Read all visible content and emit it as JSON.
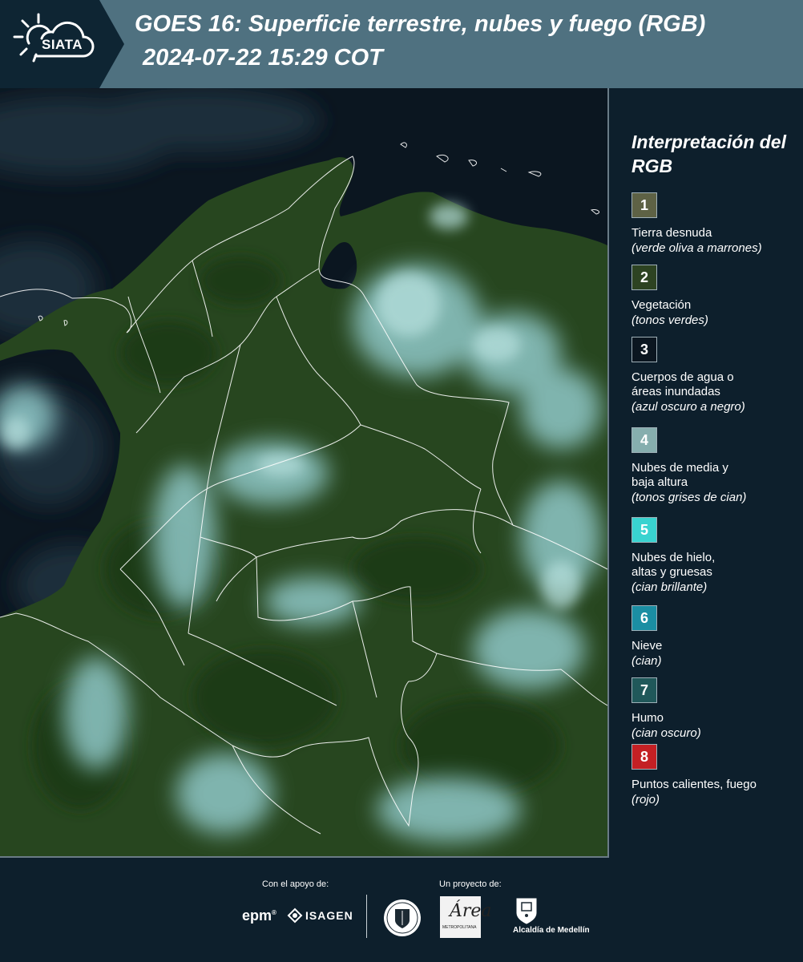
{
  "header": {
    "logo_text": "SIATA",
    "title_line1": "GOES 16: Superficie terrestre, nubes y fuego (RGB)",
    "title_line2": "2024-07-22 15:29 COT"
  },
  "map": {
    "icon": "satellite-image",
    "colors": {
      "ocean": "#0b1620",
      "vegetation": "#27461f",
      "cloud": "#8fc8c8",
      "boundary": "#ffffff"
    }
  },
  "legend": {
    "title": "Interpretación del RGB",
    "items": [
      {
        "number": "1",
        "label": "Tierra desnuda",
        "sub": "(verde oliva a marrones)",
        "color": "#5e6245"
      },
      {
        "number": "2",
        "label": "Vegetación",
        "sub": "(tonos verdes)",
        "color": "#2d4322"
      },
      {
        "number": "3",
        "label": "Cuerpos de agua o áreas inundadas",
        "sub": "(azul oscuro a negro)",
        "color": "#0b1620"
      },
      {
        "number": "4",
        "label": "Nubes de media y baja altura",
        "sub": "(tonos grises de cian)",
        "color": "#86aeae"
      },
      {
        "number": "5",
        "label": "Nubes de hielo, altas y gruesas",
        "sub": "(cian brillante)",
        "color": "#39d3d0"
      },
      {
        "number": "6",
        "label": "Nieve",
        "sub": "(cian)",
        "color": "#1b8ea3"
      },
      {
        "number": "7",
        "label": "Humo",
        "sub": "(cian oscuro)",
        "color": "#20585a"
      },
      {
        "number": "8",
        "label": "Puntos calientes, fuego",
        "sub": "(rojo)",
        "color": "#c42024"
      }
    ]
  },
  "footer": {
    "support_label": "Con el apoyo de:",
    "project_label": "Un proyecto de:",
    "epm": "epm",
    "epm_mark": "®",
    "isagen": "ISAGEN",
    "area_mark": "Área",
    "area_small": "METROPOLITANA",
    "alcaldia": "Alcaldía de Medellín"
  }
}
